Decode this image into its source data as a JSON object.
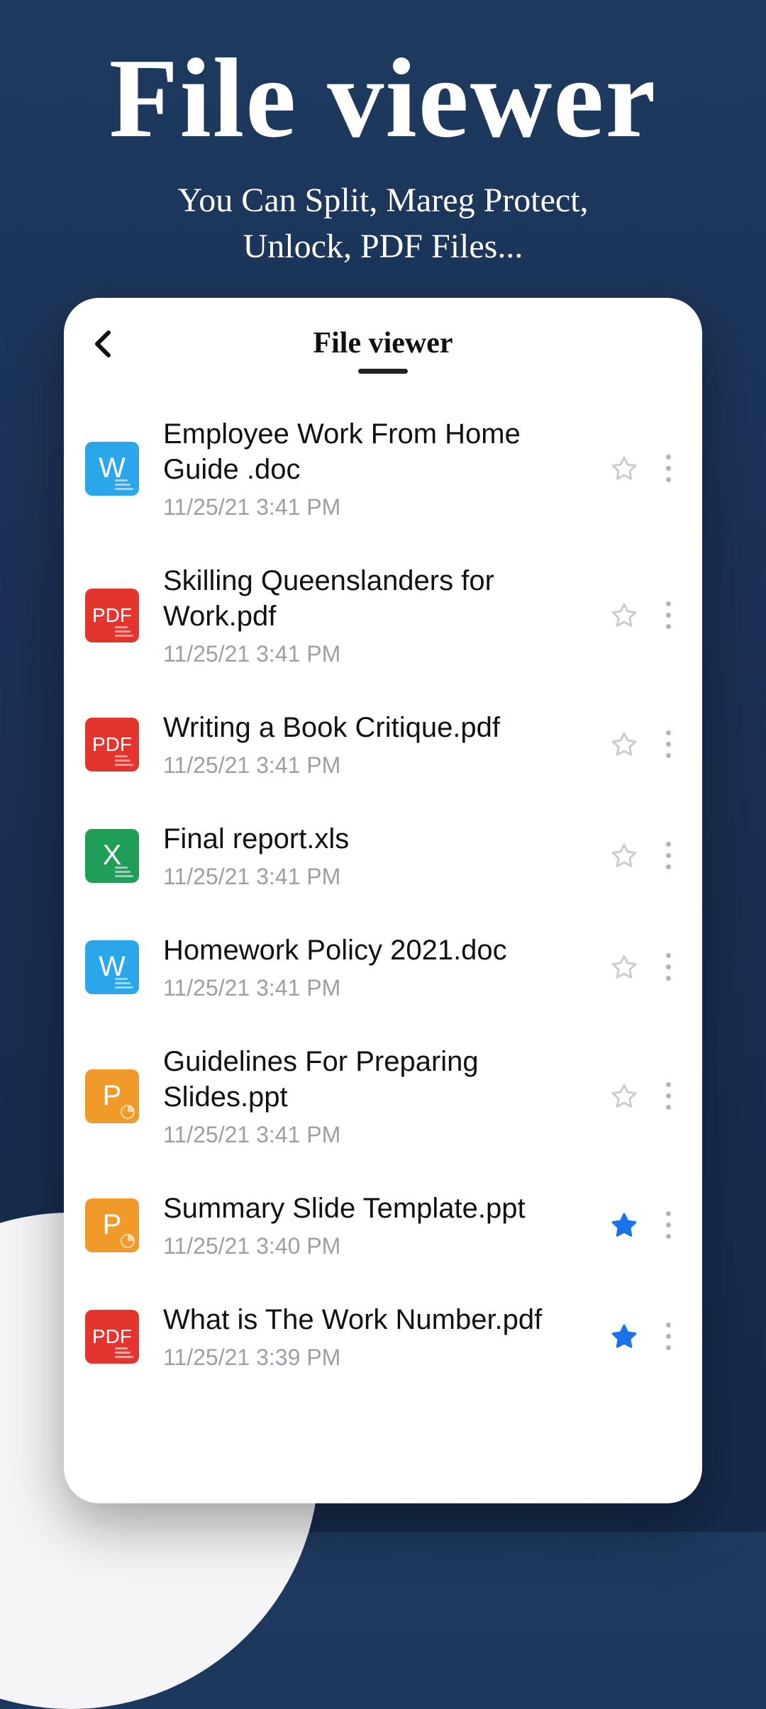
{
  "hero": {
    "title": "File viewer",
    "subtitle_line1": "You Can Split, Mareg Protect,",
    "subtitle_line2": "Unlock, PDF Files..."
  },
  "toolbar": {
    "title": "File viewer"
  },
  "fileTypes": {
    "doc": {
      "letter": "W",
      "color": "#2aa6ea",
      "deco": "lines"
    },
    "pdf": {
      "letter": "PDF",
      "color": "#e3352e",
      "deco": "lines"
    },
    "xls": {
      "letter": "X",
      "color": "#1e9e57",
      "deco": "lines"
    },
    "ppt": {
      "letter": "P",
      "color": "#f09a2a",
      "deco": "pie"
    }
  },
  "files": [
    {
      "type": "doc",
      "name": "Employee Work From Home Guide .doc",
      "date": "11/25/21 3:41 PM",
      "starred": false
    },
    {
      "type": "pdf",
      "name": "Skilling Queenslanders for Work.pdf",
      "date": "11/25/21 3:41 PM",
      "starred": false
    },
    {
      "type": "pdf",
      "name": "Writing a Book Critique.pdf",
      "date": "11/25/21 3:41 PM",
      "starred": false
    },
    {
      "type": "xls",
      "name": "Final report.xls",
      "date": "11/25/21 3:41 PM",
      "starred": false
    },
    {
      "type": "doc",
      "name": "Homework Policy 2021.doc",
      "date": "11/25/21 3:41 PM",
      "starred": false
    },
    {
      "type": "ppt",
      "name": "Guidelines For Preparing Slides.ppt",
      "date": "11/25/21 3:41 PM",
      "starred": false
    },
    {
      "type": "ppt",
      "name": "Summary Slide Template.ppt",
      "date": "11/25/21 3:40 PM",
      "starred": true
    },
    {
      "type": "pdf",
      "name": "What is The Work Number.pdf",
      "date": "11/25/21 3:39 PM",
      "starred": true
    }
  ],
  "colors": {
    "starOff": "#c9ccd0",
    "starOn": "#1a73e8"
  }
}
